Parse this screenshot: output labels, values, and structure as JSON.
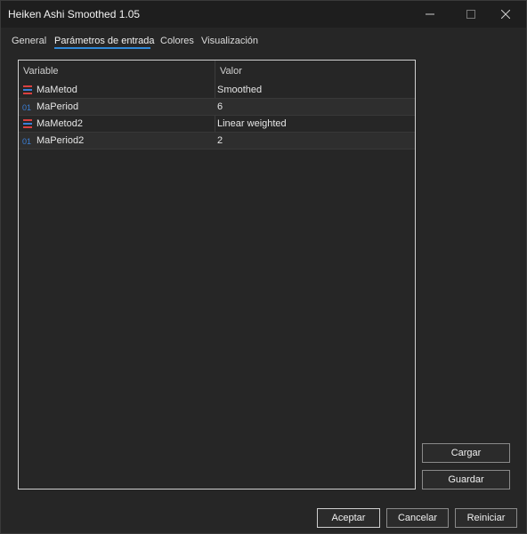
{
  "window": {
    "title": "Heiken Ashi Smoothed 1.05"
  },
  "tabs": [
    {
      "label": "General"
    },
    {
      "label": "Parámetros de entrada"
    },
    {
      "label": "Colores"
    },
    {
      "label": "Visualización"
    }
  ],
  "active_tab": "Parámetros de entrada",
  "table": {
    "headers": {
      "variable": "Variable",
      "value": "Valor"
    },
    "rows": [
      {
        "icon": "enum-list-icon",
        "name": "MaMetod",
        "value": "Smoothed"
      },
      {
        "icon": "integer-01-icon",
        "name": "MaPeriod",
        "value": "6"
      },
      {
        "icon": "enum-list-icon",
        "name": "MaMetod2",
        "value": "Linear weighted"
      },
      {
        "icon": "integer-01-icon",
        "name": "MaPeriod2",
        "value": "2"
      }
    ]
  },
  "side_buttons": {
    "load": "Cargar",
    "save": "Guardar"
  },
  "footer_buttons": {
    "ok": "Aceptar",
    "cancel": "Cancelar",
    "reset": "Reiniciar"
  },
  "colors": {
    "accent": "#2f88d8",
    "background": "#262626",
    "titlebar": "#1e1e1e",
    "enum_icon": "#d94040",
    "int_icon": "#3a7fd8"
  }
}
